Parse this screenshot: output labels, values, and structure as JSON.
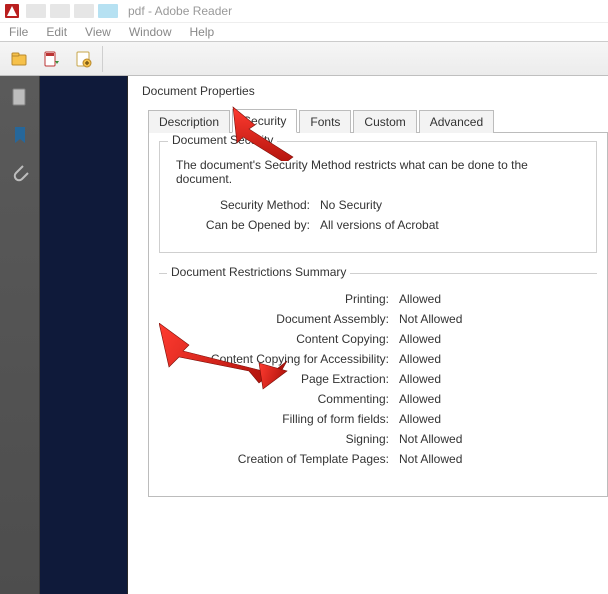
{
  "window": {
    "title": "pdf - Adobe Reader"
  },
  "menu": {
    "items": [
      "File",
      "Edit",
      "View",
      "Window",
      "Help"
    ]
  },
  "panel": {
    "title": "Document Properties",
    "tabs": [
      "Description",
      "Security",
      "Fonts",
      "Custom",
      "Advanced"
    ],
    "active_tab": "Security"
  },
  "security": {
    "group_title": "Document Security",
    "description": "The document's Security Method restricts what can be done to the document.",
    "method_label": "Security Method:",
    "method_value": "No Security",
    "opened_label": "Can be Opened by:",
    "opened_value": "All versions of Acrobat"
  },
  "restrictions": {
    "group_title": "Document Restrictions Summary",
    "rows": [
      {
        "label": "Printing:",
        "value": "Allowed"
      },
      {
        "label": "Document Assembly:",
        "value": "Not Allowed"
      },
      {
        "label": "Content Copying:",
        "value": "Allowed"
      },
      {
        "label": "Content Copying for Accessibility:",
        "value": "Allowed"
      },
      {
        "label": "Page Extraction:",
        "value": "Allowed"
      },
      {
        "label": "Commenting:",
        "value": "Allowed"
      },
      {
        "label": "Filling of form fields:",
        "value": "Allowed"
      },
      {
        "label": "Signing:",
        "value": "Not Allowed"
      },
      {
        "label": "Creation of Template Pages:",
        "value": "Not Allowed"
      }
    ]
  }
}
